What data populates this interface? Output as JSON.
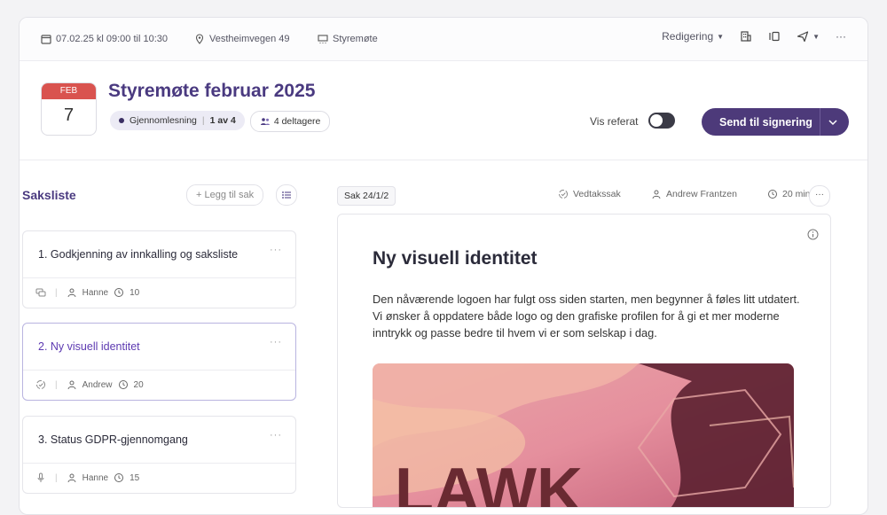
{
  "topbar": {
    "datetime": "07.02.25 kl 09:00 til 10:30",
    "location": "Vestheimvegen 49",
    "meeting_type": "Styremøte",
    "mode": "Redigering",
    "more": "···"
  },
  "header": {
    "month": "FEB",
    "day": "7",
    "title": "Styremøte februar 2025",
    "status": "Gjennomlesning",
    "progress": "1 av 4",
    "participants": "4 deltagere",
    "show_minutes_label": "Vis referat",
    "show_minutes_on": false,
    "send_button": "Send til signering"
  },
  "agenda": {
    "title": "Saksliste",
    "add_label": "+ Legg til sak",
    "items": [
      {
        "title": "1. Godkjenning av innkalling og saksliste",
        "person": "Hanne",
        "minutes": "10",
        "icon": "chat-icon"
      },
      {
        "title": "2. Ny visuell identitet",
        "person": "Andrew",
        "minutes": "20",
        "icon": "decision-icon"
      },
      {
        "title": "3. Status GDPR-gjennomgang",
        "person": "Hanne",
        "minutes": "15",
        "icon": "mic-icon"
      }
    ]
  },
  "item_detail": {
    "case_no": "Sak 24/1/2",
    "type": "Vedtakssak",
    "owner": "Andrew Frantzen",
    "duration": "20 min",
    "title": "Ny visuell identitet",
    "body": "Den nåværende logoen har fulgt oss siden starten, men begynner å føles litt utdatert. Vi ønsker å oppdatere både logo og den grafiske profilen for å gi et mer moderne inntrykk og passe bedre til hvem vi er som selskap i dag.",
    "image_text": "LAWK"
  },
  "colors": {
    "accent": "#4d3a7a",
    "title": "#4a3a80",
    "date_red": "#d9534f",
    "active_item": "#5d3ab1"
  }
}
